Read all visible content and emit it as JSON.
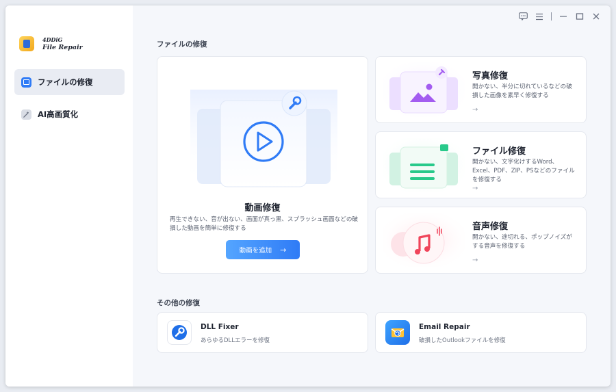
{
  "brand": {
    "line1": "4DDiG",
    "line2": "File Repair"
  },
  "sidebar": {
    "items": [
      {
        "label": "ファイルの修復",
        "icon": "file-repair-icon",
        "active": true
      },
      {
        "label": "AI高画質化",
        "icon": "ai-enhance-icon",
        "active": false
      }
    ]
  },
  "topbar": {
    "icons": [
      "feedback-icon",
      "menu-icon",
      "minimize-icon",
      "maximize-icon",
      "close-icon"
    ]
  },
  "main": {
    "section_title": "ファイルの修復",
    "video": {
      "title": "動画修復",
      "description": "再生できない、音が出ない、画面が真っ黒、スプラッシュ画面などの破損した動画を簡単に修復する",
      "button_label": "動画を追加",
      "button_arrow": "→"
    },
    "photo": {
      "title": "写真修復",
      "description": "開かない、半分に切れているなどの破損した画像を素早く修復する",
      "arrow": "→"
    },
    "file": {
      "title": "ファイル修復",
      "description": "開かない、文字化けするWord、Excel、PDF、ZIP、PSなどのファイルを修復する",
      "arrow": "→"
    },
    "audio": {
      "title": "音声修復",
      "description": "開かない、途切れる、ポップノイズがする音声を修復する",
      "arrow": "→"
    },
    "other_section_title": "その他の修復",
    "other": [
      {
        "title": "DLL Fixer",
        "description": "あらゆるDLLエラーを修復",
        "icon": "dll-fixer-icon"
      },
      {
        "title": "Email Repair",
        "description": "破損したOutlookファイルを修復",
        "icon": "email-repair-icon"
      }
    ]
  },
  "colors": {
    "accent": "#2f7bf6",
    "photo": "#a35cf0",
    "file": "#28c98a",
    "audio": "#f0445a"
  }
}
